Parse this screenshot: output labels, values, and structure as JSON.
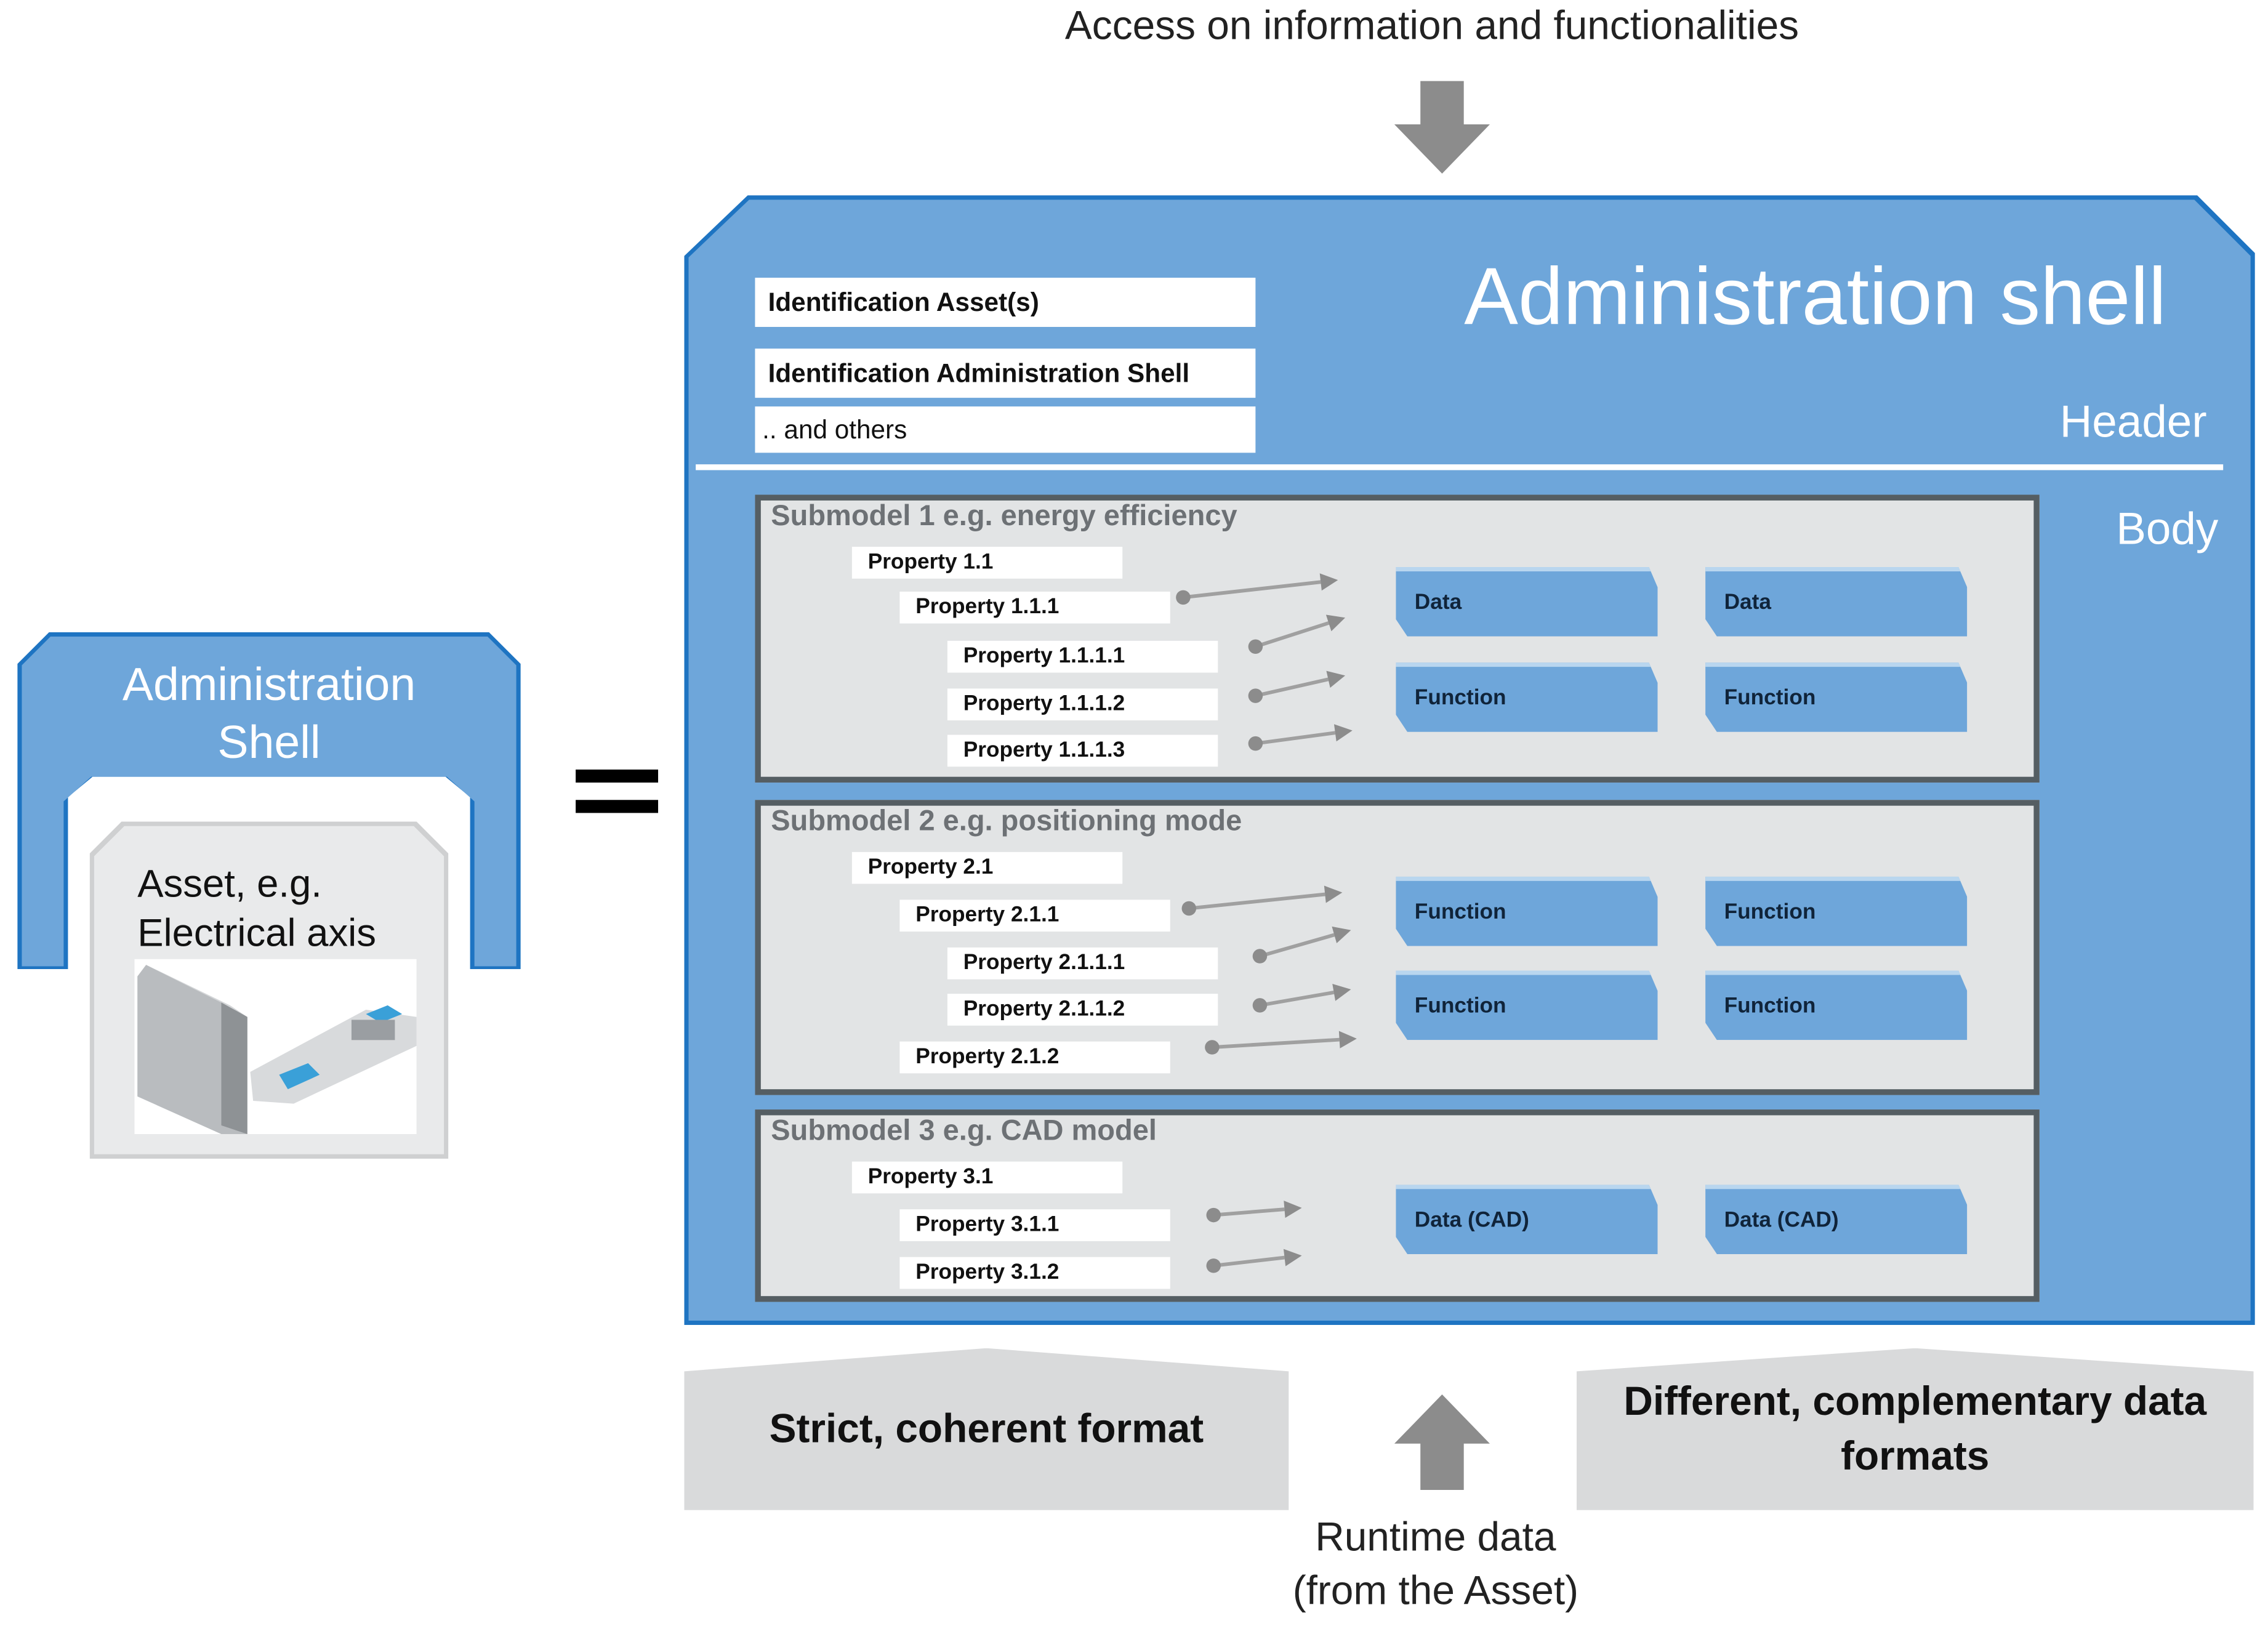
{
  "top_caption": "Access on information and functionalities",
  "shell": {
    "title": "Administration shell",
    "header_label": "Header",
    "body_label": "Body",
    "identification": [
      "Identification Asset(s)",
      "Identification Administration Shell",
      ".. and others"
    ]
  },
  "submodels": [
    {
      "title": "Submodel 1 e.g. energy efficiency",
      "properties": [
        {
          "label": "Property 1.1",
          "level": 1
        },
        {
          "label": "Property 1.1.1",
          "level": 2
        },
        {
          "label": "Property 1.1.1.1",
          "level": 3
        },
        {
          "label": "Property 1.1.1.2",
          "level": 3
        },
        {
          "label": "Property 1.1.1.3",
          "level": 3
        }
      ],
      "blocks": [
        "Data",
        "Data",
        "Function",
        "Function"
      ]
    },
    {
      "title": "Submodel 2 e.g. positioning mode",
      "properties": [
        {
          "label": "Property 2.1",
          "level": 1
        },
        {
          "label": "Property 2.1.1",
          "level": 2
        },
        {
          "label": "Property 2.1.1.1",
          "level": 3
        },
        {
          "label": "Property 2.1.1.2",
          "level": 3
        },
        {
          "label": "Property 2.1.2",
          "level": 2
        }
      ],
      "blocks": [
        "Function",
        "Function",
        "Function",
        "Function"
      ]
    },
    {
      "title": "Submodel 3 e.g. CAD model",
      "properties": [
        {
          "label": "Property 3.1",
          "level": 1
        },
        {
          "label": "Property 3.1.1",
          "level": 2
        },
        {
          "label": "Property 3.1.2",
          "level": 2
        }
      ],
      "blocks": [
        "Data (CAD)",
        "Data (CAD)"
      ]
    }
  ],
  "bottom": {
    "left_banner": "Strict, coherent format",
    "right_banner": "Different, complementary data formats",
    "runtime_line1": "Runtime data",
    "runtime_line2": "(from the Asset)"
  },
  "left_shell": {
    "title_line1": "Administration",
    "title_line2": "Shell",
    "asset_line1": "Asset, e.g.",
    "asset_line2": "Electrical axis"
  },
  "colors": {
    "shell_blue": "#6ea6da",
    "shell_border": "#1e74c2",
    "submodel_bg": "#e2e4e5",
    "arrow_gray": "#8c8c8c"
  }
}
